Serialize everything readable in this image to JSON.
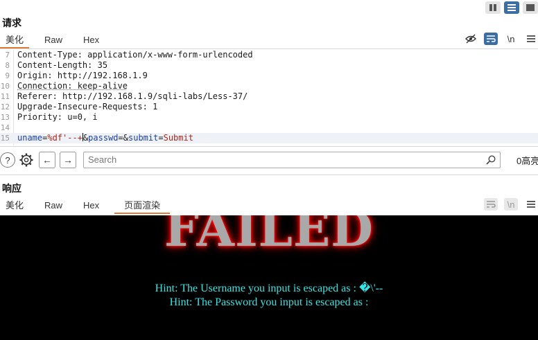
{
  "request": {
    "title": "请求",
    "tabs": [
      "美化",
      "Raw",
      "Hex"
    ],
    "icons": [
      "eye-off-icon",
      "wrap-icon",
      "newline-icon",
      "menu-icon"
    ],
    "newline_label": "\\n",
    "lines": [
      {
        "num": "7",
        "key": "Content-Type",
        "value": "application/x-www-form-urlencoded"
      },
      {
        "num": "8",
        "key": "Content-Length",
        "value": "35"
      },
      {
        "num": "9",
        "key": "Origin",
        "value": "http://192.168.1.9"
      },
      {
        "num": "10",
        "key": "Connection",
        "value": "keep-alive"
      },
      {
        "num": "11",
        "key": "Referer",
        "value": "http://192.168.1.9/sqli-labs/Less-37/"
      },
      {
        "num": "12",
        "key": "Upgrade-Insecure-Requests",
        "value": "1"
      },
      {
        "num": "13",
        "key": "Priority",
        "value": "u=0, i"
      },
      {
        "num": "14",
        "key": "",
        "value": ""
      }
    ],
    "body_line": {
      "num": "15",
      "p1_name": "uname",
      "p1_value": "%df'--+",
      "p2_name": "passwd",
      "p2_value": "",
      "p3_name": "submit",
      "p3_value": "Submit"
    }
  },
  "search": {
    "placeholder": "Search",
    "highlight_count": "0高亮"
  },
  "response": {
    "title": "响应",
    "tabs": [
      "美化",
      "Raw",
      "Hex",
      "页面渲染"
    ],
    "newline_label": "\\n",
    "failed_text": "FAILED",
    "hint_username": "Hint: The Username you input is escaped as : �\\'--",
    "hint_password": "Hint: The Password you input is escaped as :"
  },
  "colors": {
    "accent_orange": "#e07b39",
    "active_blue": "#3a6ea5",
    "hint_cyan": "#33e6e6",
    "param_name": "#1a3fb0",
    "param_value": "#b0281a"
  }
}
